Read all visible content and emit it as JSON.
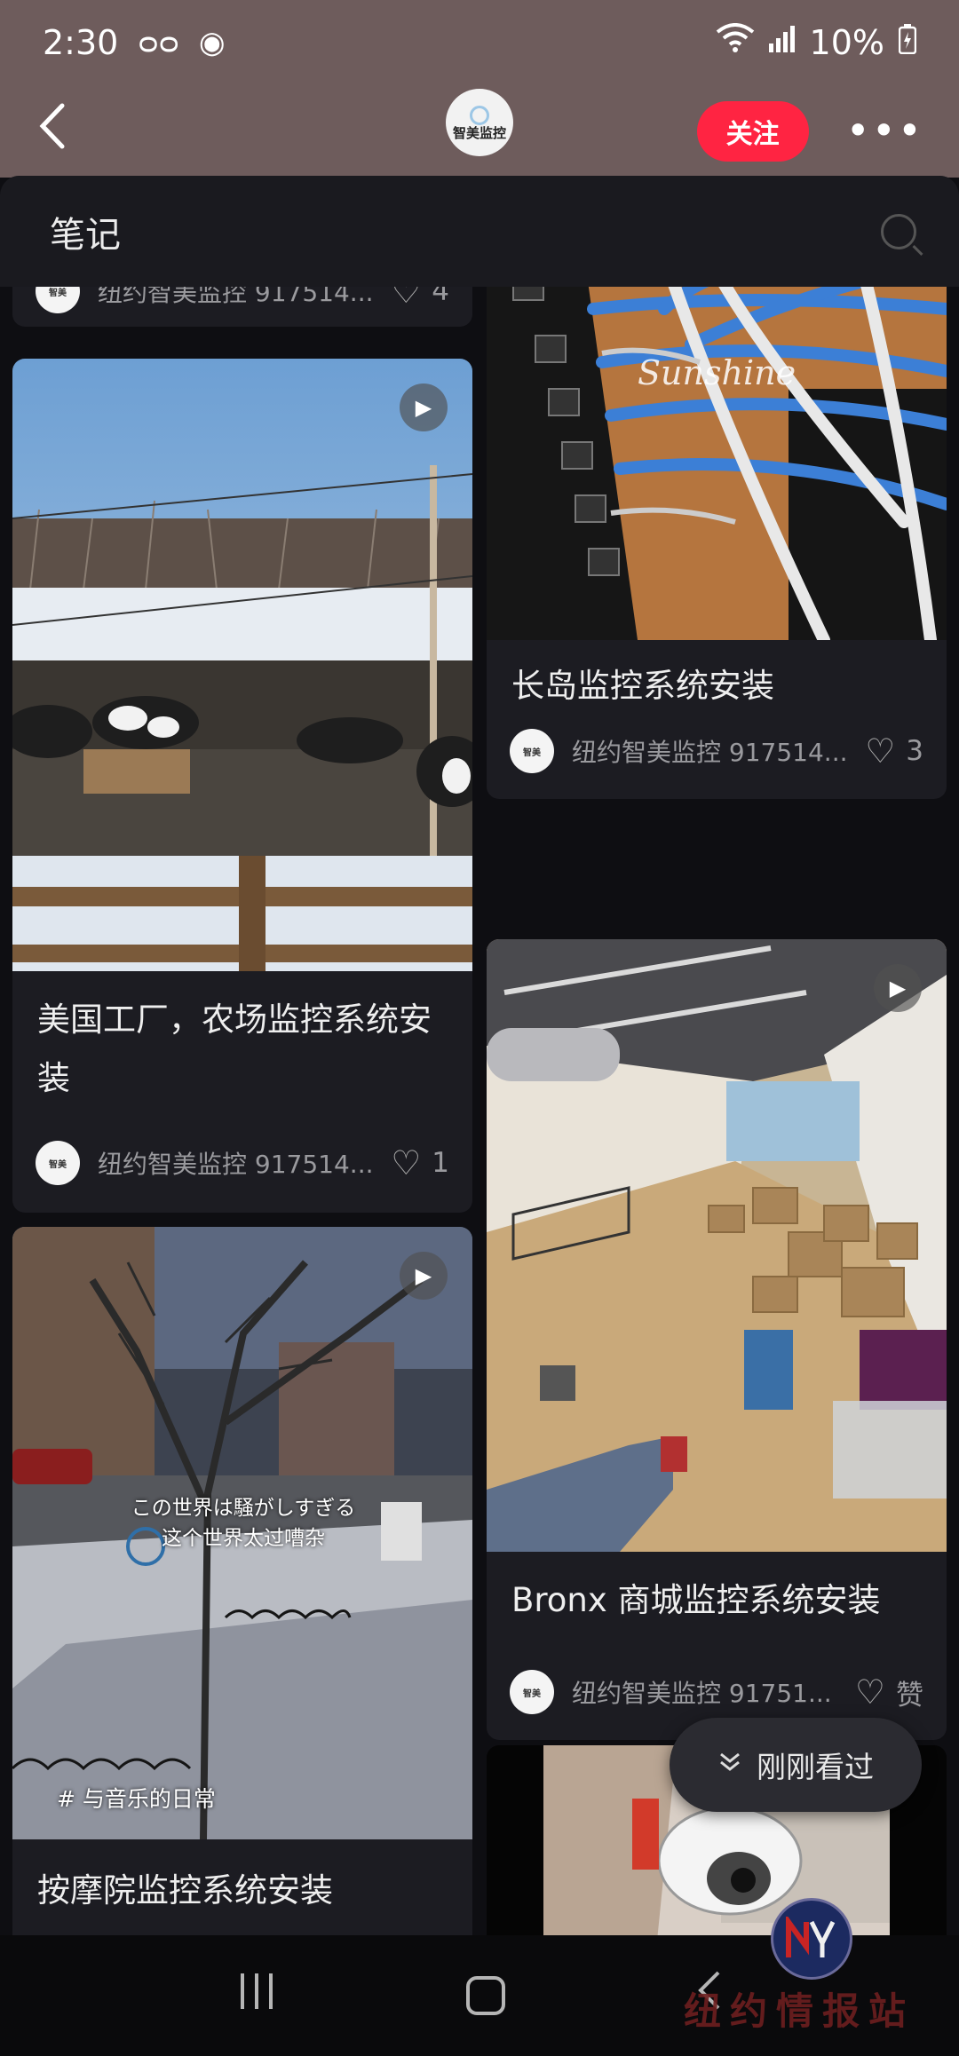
{
  "status_bar": {
    "time": "2:30",
    "left_icons": [
      "voicemail-icon",
      "sync-icon"
    ],
    "battery": "10%"
  },
  "header": {
    "logo_text": "智美监控",
    "follow_label": "关注",
    "more_label": "•••"
  },
  "sheet": {
    "title": "笔记"
  },
  "cards": [
    {
      "id": "c0",
      "title": "",
      "author": "纽约智美监控 917514...",
      "likes": "4"
    },
    {
      "id": "c1",
      "title": "美国工厂，农场监控系统安装",
      "author": "纽约智美监控 917514...",
      "likes": "1",
      "has_video": true
    },
    {
      "id": "c2",
      "title": "长岛监控系统安装",
      "author": "纽约智美监控 917514...",
      "likes": "3",
      "image_brand": "Sunshine"
    },
    {
      "id": "c3",
      "title": "Bronx 商城监控系统安装",
      "author": "纽约智美监控 91751...",
      "likes": "赞",
      "has_video": true
    },
    {
      "id": "c4",
      "title": "按摩院监控系统安装",
      "has_video": true,
      "overlay_jp": "この世界は騒がしすぎる",
      "overlay_cn": "这个世界太过嘈杂",
      "hashtag": "与音乐的日常"
    },
    {
      "id": "c5",
      "title": ""
    }
  ],
  "recent_button": {
    "label": "刚刚看过"
  },
  "watermark": {
    "text": "纽约情报站"
  }
}
